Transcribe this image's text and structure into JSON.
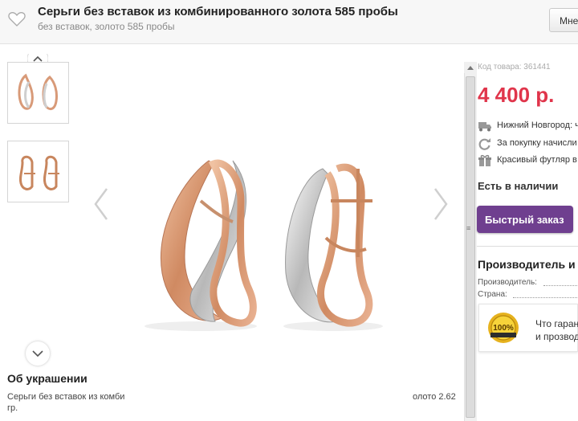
{
  "header": {
    "title": "Серьги без вставок из комбинированного золота 585 пробы",
    "subtitle": "без вставок, золото 585 пробы",
    "button_label": "Мне"
  },
  "gallery": {
    "thumbnails": [
      {
        "alt": "earrings-front-thumb"
      },
      {
        "alt": "earrings-side-thumb"
      }
    ]
  },
  "description": {
    "heading": "Об украшении",
    "text_left": "Серьги без вставок из комби",
    "text_left_line2": "гр.",
    "text_right": "олото 2.62"
  },
  "product": {
    "code": "Код товара: 361441",
    "price": "4 400 р.",
    "info": [
      {
        "icon": "truck-icon",
        "text": "Нижний Новгород: ч"
      },
      {
        "icon": "refresh-icon",
        "text": "За покупку начисли"
      },
      {
        "icon": "gift-icon",
        "text": "Красивый футляр в"
      }
    ],
    "stock": "Есть в наличии",
    "quick_order": "Быстрый заказ",
    "maker_heading": "Производитель и",
    "specs": [
      {
        "label": "Производитель:"
      },
      {
        "label": "Страна:"
      }
    ],
    "guarantee": {
      "badge_text": "100%",
      "line1": "Что гаран",
      "line2": "и прозвод"
    }
  },
  "colors": {
    "accent_purple": "#6f3f8f",
    "price_red": "#e0354b",
    "gold_rose": "#d89a78",
    "white_gold": "#d6d6d6"
  }
}
